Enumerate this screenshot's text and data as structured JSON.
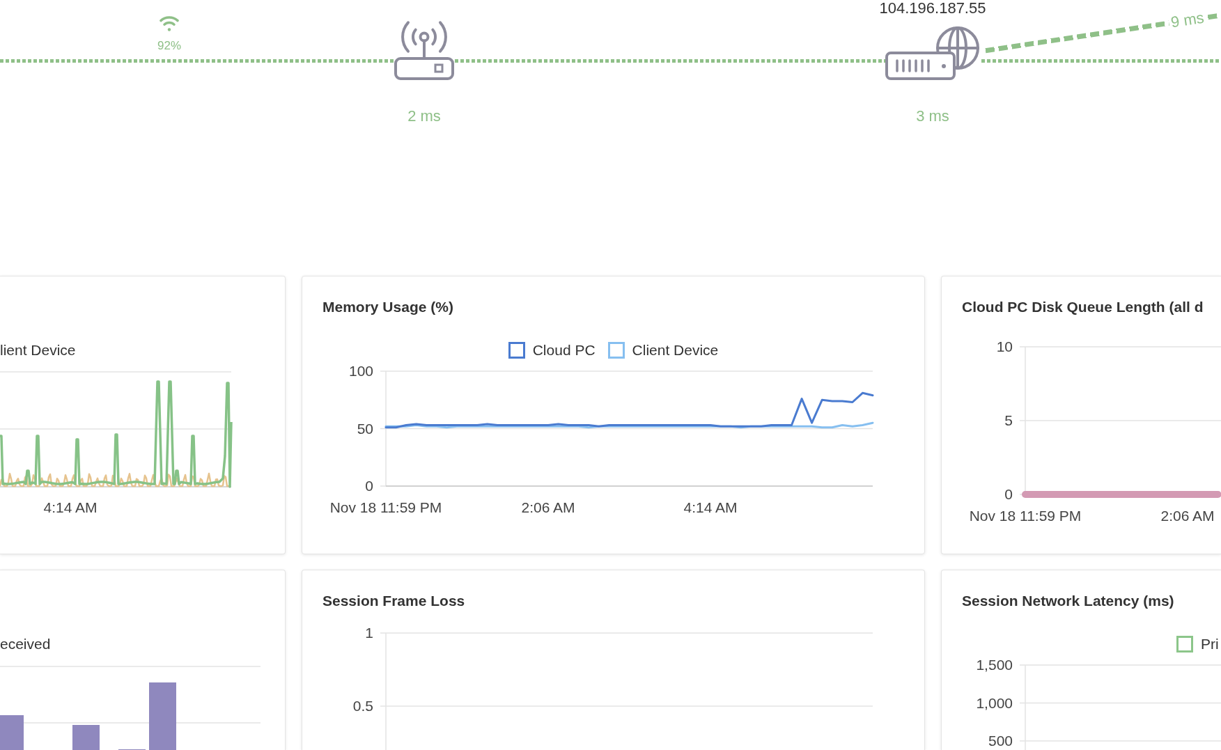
{
  "network_path": {
    "wifi_signal": "92%",
    "hops": [
      {
        "kind": "router",
        "latency": "2 ms"
      },
      {
        "kind": "server",
        "address": "104.196.187.55",
        "latency": "3 ms"
      }
    ],
    "branch_latency": "9 ms"
  },
  "cards": [
    {
      "kind": "line_picture",
      "legend_label": "lient Device",
      "x_tick": "4:14 AM"
    },
    {
      "kind": "line_chart",
      "title": "Memory Usage (%)",
      "chart_data": {
        "type": "line",
        "categories": [
          "Nov 18 11:59 PM",
          null,
          null,
          null,
          null,
          null,
          null,
          null,
          null,
          null,
          null,
          null,
          null,
          null,
          null,
          null,
          "2:06 AM",
          null,
          null,
          null,
          null,
          null,
          null,
          null,
          null,
          null,
          null,
          null,
          null,
          null,
          null,
          null,
          "4:14 AM",
          null,
          null,
          null,
          null,
          null,
          null,
          null,
          null,
          null,
          null,
          null,
          null,
          null,
          null,
          null,
          null
        ],
        "ylim": [
          0,
          100
        ],
        "yticks": [
          0,
          50,
          100
        ],
        "series": [
          {
            "name": "Cloud PC",
            "color": "#4a7bd0",
            "values": [
              51,
              51,
              53,
              54,
              53,
              53,
              53,
              53,
              53,
              53,
              54,
              53,
              53,
              53,
              53,
              53,
              53,
              54,
              53,
              53,
              53,
              52,
              53,
              53,
              53,
              53,
              53,
              53,
              53,
              53,
              53,
              53,
              53,
              52,
              52,
              52,
              52,
              52,
              53,
              53,
              53,
              76,
              55,
              75,
              74,
              74,
              73,
              81,
              79
            ]
          },
          {
            "name": "Client Device",
            "color": "#86bff0",
            "values": [
              52,
              52,
              52,
              53,
              52,
              52,
              51,
              52,
              52,
              52,
              52,
              52,
              52,
              52,
              52,
              52,
              52,
              52,
              52,
              52,
              51,
              52,
              52,
              52,
              52,
              52,
              52,
              52,
              52,
              52,
              52,
              52,
              52,
              52,
              52,
              51,
              52,
              52,
              52,
              52,
              52,
              52,
              52,
              51,
              51,
              53,
              52,
              53,
              55
            ]
          }
        ]
      }
    },
    {
      "kind": "line_chart",
      "title": "Cloud PC Disk Queue Length (all d",
      "chart_data": {
        "type": "line",
        "categories": [
          "Nov 18 11:59 PM",
          null,
          null,
          null,
          null,
          null,
          null,
          null,
          null,
          null,
          null,
          null,
          null,
          null,
          null,
          null,
          "2:06 AM",
          null,
          null,
          null
        ],
        "ylim": [
          0,
          10
        ],
        "yticks": [
          0,
          5,
          10
        ],
        "series": [
          {
            "color": "#d39ab3",
            "values": [
              0,
              0,
              0,
              0,
              0,
              0,
              0,
              0,
              0,
              0,
              0,
              0,
              0,
              0,
              0,
              0,
              0,
              0,
              0,
              0
            ]
          }
        ]
      }
    },
    {
      "kind": "bar_picture",
      "legend_label": "eceived"
    },
    {
      "kind": "empty_chart",
      "title": "Session Frame Loss",
      "y_axis_labels": [
        "1",
        "0.5"
      ]
    },
    {
      "kind": "empty_chart",
      "title": "Session Network Latency (ms)",
      "legend": [
        {
          "label": "Pri",
          "color": "#8cc68a"
        }
      ],
      "y_axis_labels": [
        "1,500",
        "1,000",
        "500"
      ]
    }
  ]
}
